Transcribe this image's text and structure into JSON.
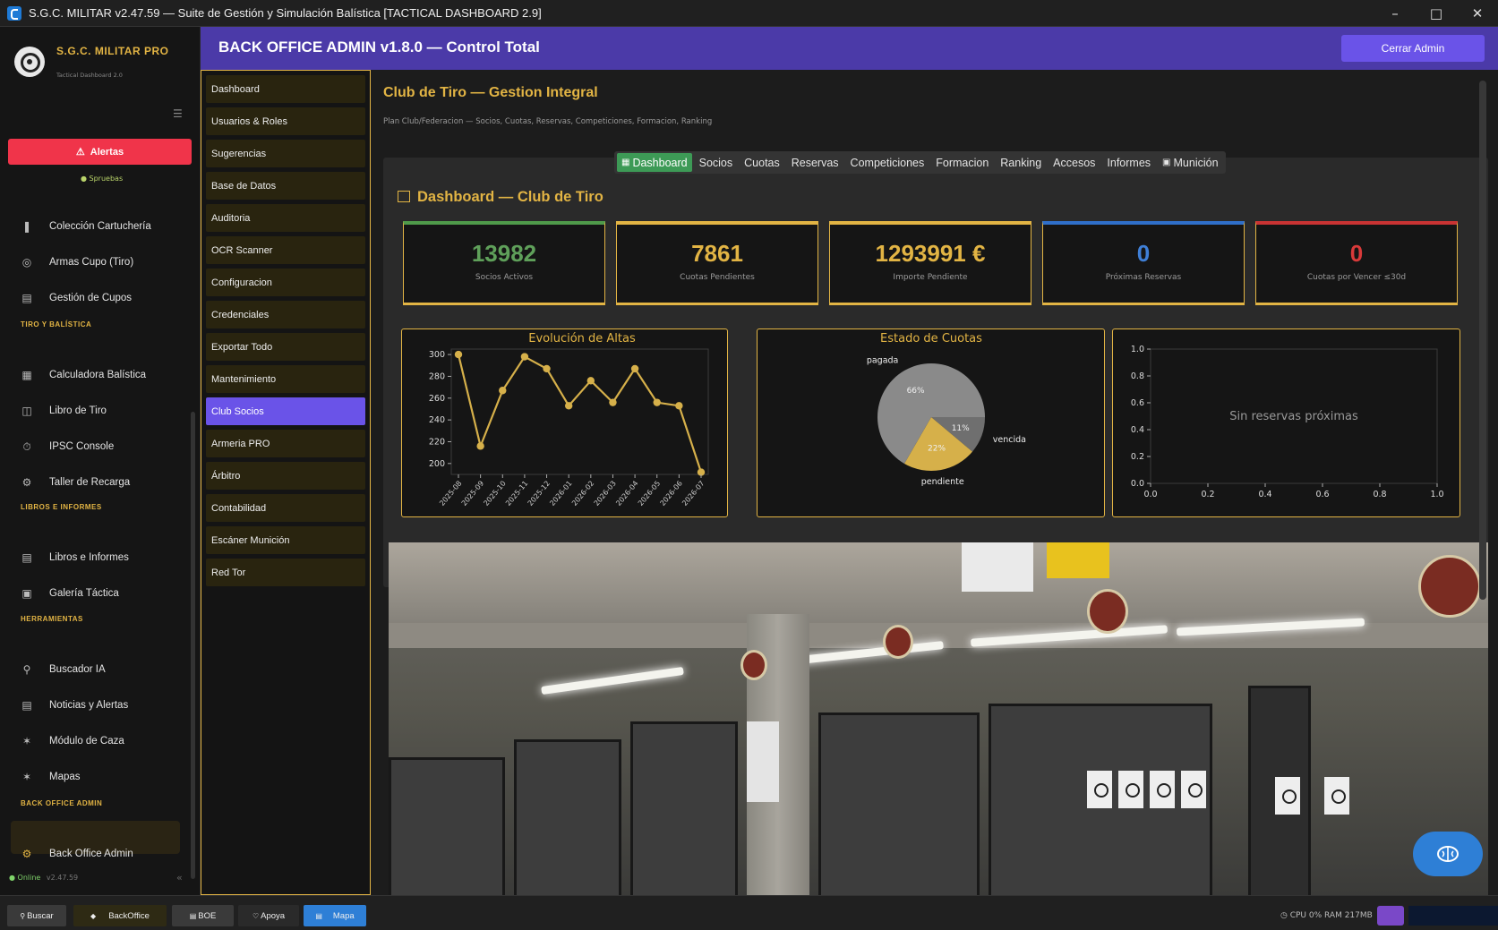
{
  "window": {
    "title": "S.G.C. MILITAR v2.47.59 — Suite de Gestión y Simulación Balística [TACTICAL DASHBOARD 2.9]"
  },
  "sidebar": {
    "brand_title": "S.G.C. MILITAR PRO",
    "brand_subtitle": "Tactical Dashboard 2.0",
    "alerts_label": "Alertas",
    "status_tag": "● Spruebas",
    "items": [
      {
        "label": "Colección Cartuchería",
        "icon": "bullet-icon"
      },
      {
        "label": "Armas Cupo (Tiro)",
        "icon": "target-icon"
      },
      {
        "label": "Gestión de Cupos",
        "icon": "clipboard-icon"
      }
    ],
    "sections": [
      {
        "title": "TIRO Y BALÍSTICA",
        "items": [
          {
            "label": "Calculadora Balística",
            "icon": "calculator-icon"
          },
          {
            "label": "Libro de Tiro",
            "icon": "book-icon"
          },
          {
            "label": "IPSC Console",
            "icon": "timer-icon"
          },
          {
            "label": "Taller de Recarga",
            "icon": "wrench-icon"
          }
        ]
      },
      {
        "title": "LIBROS E INFORMES",
        "items": [
          {
            "label": "Libros e Informes",
            "icon": "document-icon"
          },
          {
            "label": "Galería Táctica",
            "icon": "image-icon"
          }
        ]
      },
      {
        "title": "HERRAMIENTAS",
        "items": [
          {
            "label": "Buscador IA",
            "icon": "search-icon"
          },
          {
            "label": "Noticias y Alertas",
            "icon": "news-icon"
          },
          {
            "label": "Módulo de Caza",
            "icon": "tree-icon"
          },
          {
            "label": "Mapas",
            "icon": "tree-icon"
          }
        ]
      },
      {
        "title": "BACK OFFICE ADMIN",
        "items": [
          {
            "label": "Back Office Admin",
            "icon": "gear-icon"
          }
        ]
      }
    ],
    "online_label": "● Online",
    "version": "v2.47.59"
  },
  "header": {
    "title": "BACK OFFICE ADMIN v1.8.0 — Control Total",
    "close_label": "Cerrar Admin"
  },
  "admin_menu": [
    "Dashboard",
    "Usuarios & Roles",
    "Sugerencias",
    "Base de Datos",
    "Auditoria",
    "OCR Scanner",
    "Configuracion",
    "Credenciales",
    "Exportar Todo",
    "Mantenimiento",
    "Club Socios",
    "Armeria PRO",
    "Árbitro",
    "Contabilidad",
    "Escáner Munición",
    "Red Tor"
  ],
  "admin_menu_active": "Club Socios",
  "content": {
    "title": "Club de Tiro — Gestion Integral",
    "subtitle": "Plan Club/Federacion — Socios, Cuotas, Reservas, Competiciones, Formacion, Ranking",
    "tabs": [
      "Dashboard",
      "Socios",
      "Cuotas",
      "Reservas",
      "Competiciones",
      "Formacion",
      "Ranking",
      "Accesos",
      "Informes",
      "Munición"
    ],
    "active_tab": "Dashboard",
    "dashboard_title": "Dashboard — Club de Tiro",
    "kpis": [
      {
        "value": "13982",
        "label": "Socios Activos",
        "color": "#5fa05a",
        "top": "#4f9a4a"
      },
      {
        "value": "7861",
        "label": "Cuotas Pendientes",
        "color": "#e2b444",
        "top": "#e2b444"
      },
      {
        "value": "1293991 €",
        "label": "Importe Pendiente",
        "color": "#e2b444",
        "top": "#e2b444"
      },
      {
        "value": "0",
        "label": "Próximas Reservas",
        "color": "#3f7fd6",
        "top": "#2f6fc9"
      },
      {
        "value": "0",
        "label": "Cuotas por Vencer ≤30d",
        "color": "#d93a3a",
        "top": "#c93333"
      }
    ]
  },
  "chart_data": [
    {
      "type": "line",
      "title": "Evolución de Altas",
      "x": [
        "2025-08",
        "2025-09",
        "2025-10",
        "2025-11",
        "2025-12",
        "2026-01",
        "2026-02",
        "2026-03",
        "2026-04",
        "2026-05",
        "2026-06",
        "2026-07"
      ],
      "values": [
        300,
        216,
        267,
        298,
        287,
        253,
        276,
        256,
        287,
        256,
        253,
        192
      ],
      "ylim": [
        190,
        305
      ],
      "yticks": [
        200,
        220,
        240,
        260,
        280,
        300
      ],
      "color": "#d6b04a"
    },
    {
      "type": "pie",
      "title": "Estado de Cuotas",
      "labels": [
        "pagada",
        "vencida",
        "pendiente"
      ],
      "values": [
        66,
        11,
        22
      ],
      "pct_labels": [
        "66%",
        "11%",
        "22%"
      ],
      "colors": [
        "#8a8a8a",
        "#6f6f6f",
        "#d6b04a"
      ]
    },
    {
      "type": "scatter",
      "title": "",
      "empty_message": "Sin reservas próximas",
      "xlim": [
        0,
        1
      ],
      "ylim": [
        0,
        1
      ],
      "xticks": [
        "0.0",
        "0.2",
        "0.4",
        "0.6",
        "0.8",
        "1.0"
      ],
      "yticks": [
        "0.0",
        "0.2",
        "0.4",
        "0.6",
        "0.8",
        "1.0"
      ]
    }
  ],
  "taskbar": {
    "buttons": [
      {
        "label": "Buscar",
        "color": "#3a3a3a"
      },
      {
        "label": "BackOffice",
        "color": "#2e2a14"
      },
      {
        "label": "BOE",
        "color": "#3a3a3a"
      },
      {
        "label": "Apoya",
        "color": "#2a2a2a"
      },
      {
        "label": "Mapa",
        "color": "#2e7fd6"
      }
    ],
    "status": "CPU 0%  RAM 217MB"
  }
}
